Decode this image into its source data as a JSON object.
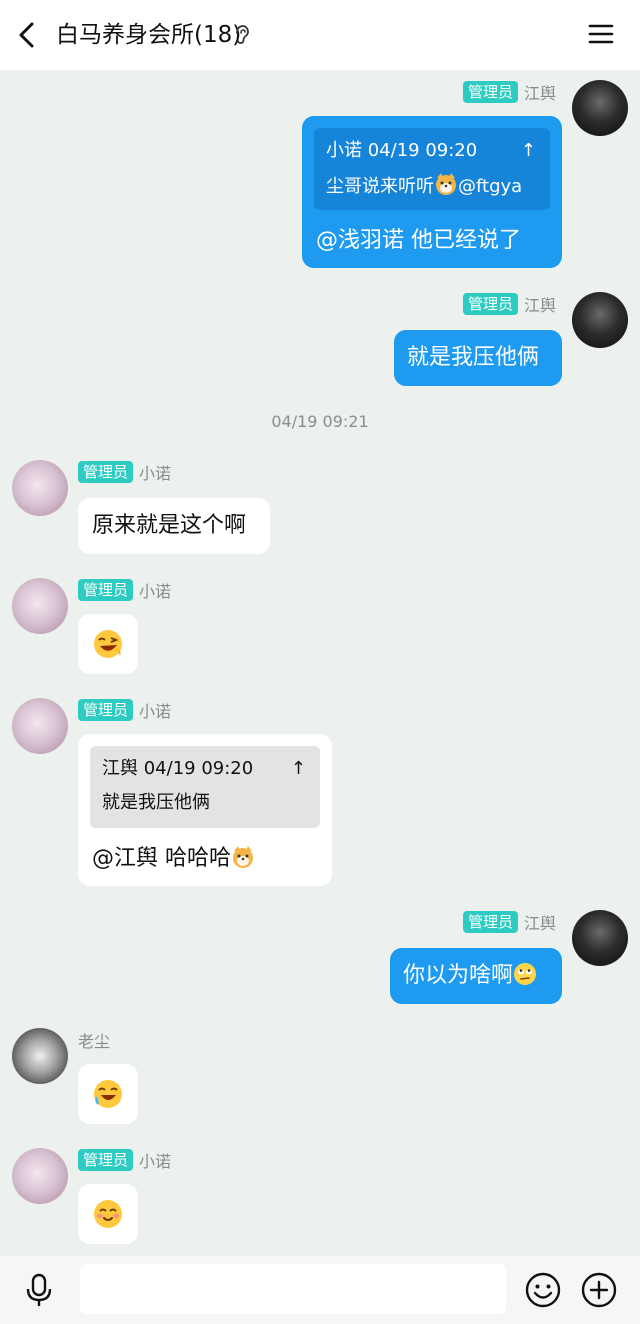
{
  "header": {
    "title": "白马养身会所(18)"
  },
  "colors": {
    "self_bubble": "#1e9bf0",
    "other_bubble": "#ffffff",
    "badge": "#2dcbc2",
    "background": "#edf1ed"
  },
  "messages": [
    {
      "sender": "江舆",
      "badge": "管理员",
      "side": "right",
      "quote": {
        "author_time": "小诺 04/19 09:20",
        "text": "尘哥说来听听",
        "mention": "@ftgya",
        "arrow": "↑"
      },
      "text": "@浅羽诺 他已经说了"
    },
    {
      "sender": "江舆",
      "badge": "管理员",
      "side": "right",
      "text": "就是我压他俩"
    },
    {
      "sender": "小诺",
      "badge": "管理员",
      "side": "left",
      "text": "原来就是这个啊"
    },
    {
      "sender": "小诺",
      "badge": "管理员",
      "side": "left",
      "emoji": "laughing-face"
    },
    {
      "sender": "小诺",
      "badge": "管理员",
      "side": "left",
      "quote": {
        "author_time": "江舆 04/19 09:20",
        "text": "就是我压他俩",
        "arrow": "↑"
      },
      "text": "@江舆 哈哈哈"
    },
    {
      "sender": "江舆",
      "badge": "管理员",
      "side": "right",
      "text": "你以为啥啊"
    },
    {
      "sender": "老尘",
      "side": "left",
      "emoji": "laugh-tears-face"
    },
    {
      "sender": "小诺",
      "badge": "管理员",
      "side": "left",
      "emoji": "blushing-smile-face"
    }
  ],
  "timestamp": "04/19 09:21",
  "input": {
    "placeholder": ""
  },
  "icons": {
    "back": "back-arrow-icon",
    "ear": "ear-icon",
    "menu": "menu-icon",
    "mic": "microphone-icon",
    "emoji": "emoji-icon",
    "plus": "plus-icon"
  }
}
